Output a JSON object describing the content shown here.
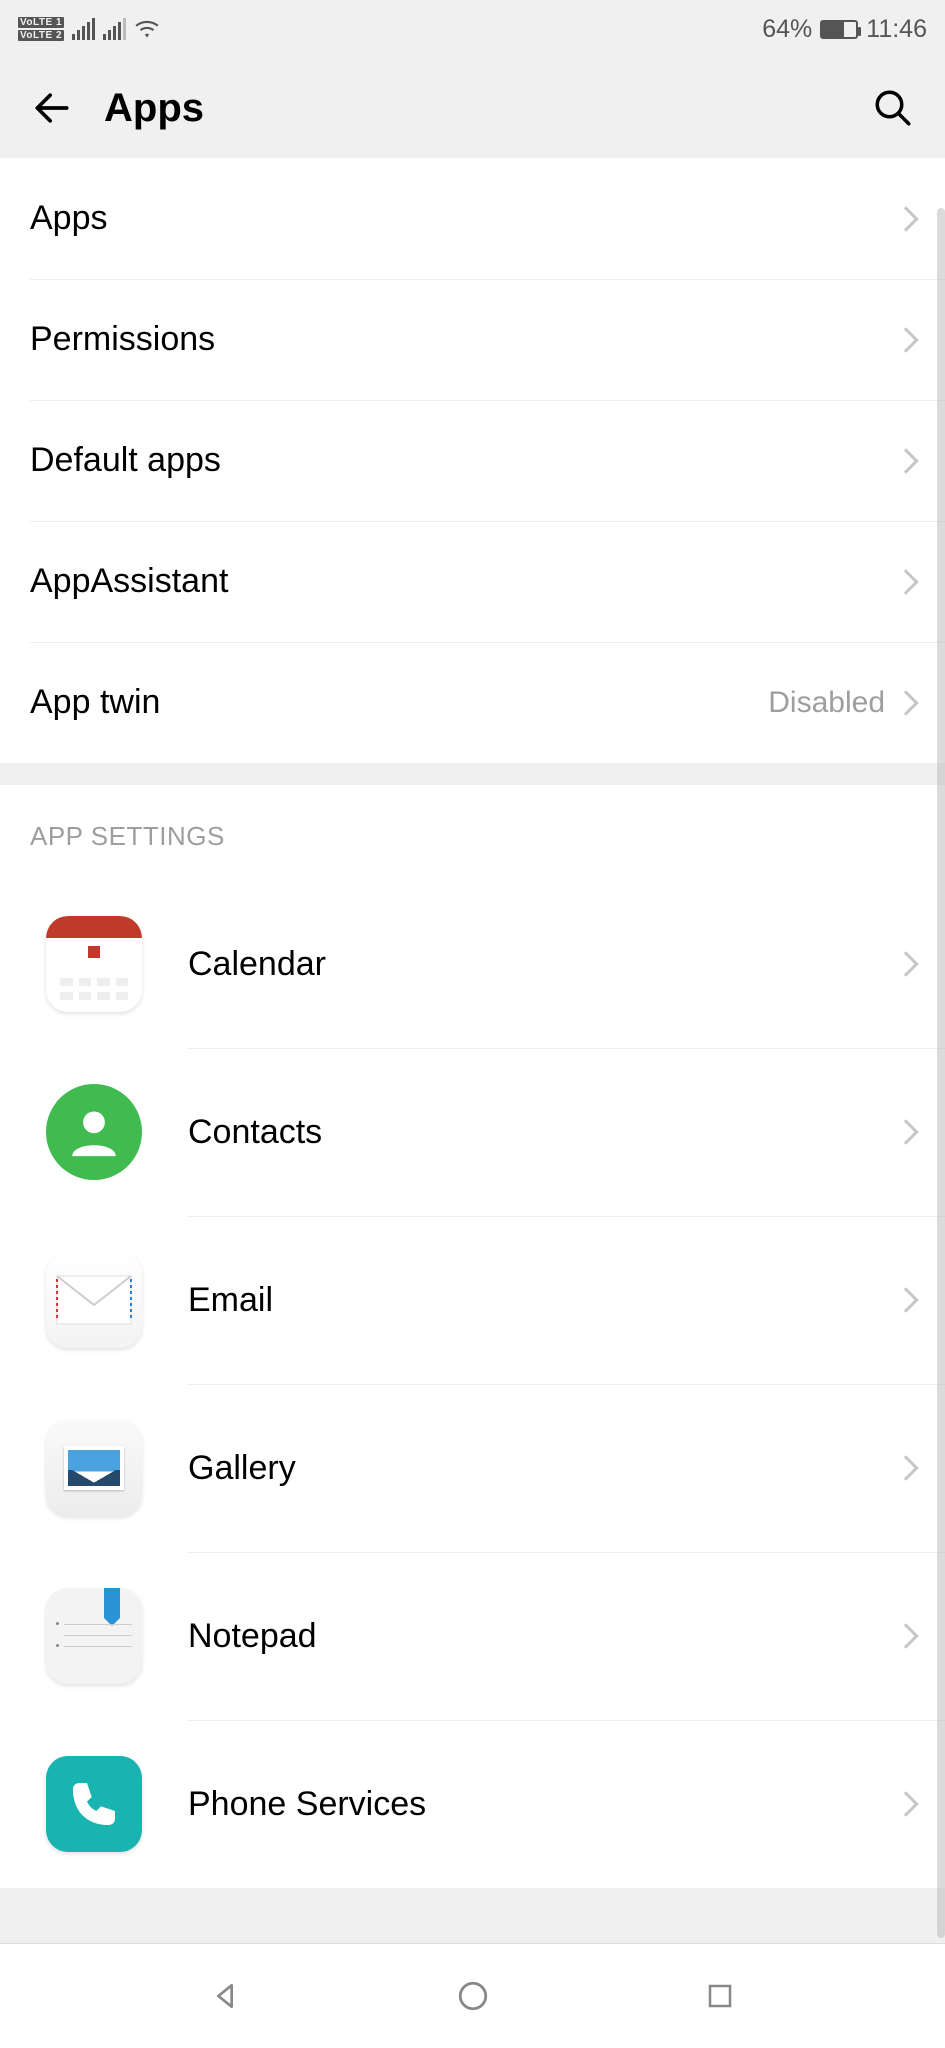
{
  "status": {
    "battery_pct": "64%",
    "time": "11:46"
  },
  "header": {
    "title": "Apps"
  },
  "section1": {
    "items": [
      {
        "label": "Apps",
        "status": ""
      },
      {
        "label": "Permissions",
        "status": ""
      },
      {
        "label": "Default apps",
        "status": ""
      },
      {
        "label": "AppAssistant",
        "status": ""
      },
      {
        "label": "App twin",
        "status": "Disabled"
      }
    ]
  },
  "section2": {
    "title": "APP SETTINGS",
    "items": [
      {
        "label": "Calendar"
      },
      {
        "label": "Contacts"
      },
      {
        "label": "Email"
      },
      {
        "label": "Gallery"
      },
      {
        "label": "Notepad"
      },
      {
        "label": "Phone Services"
      }
    ]
  }
}
